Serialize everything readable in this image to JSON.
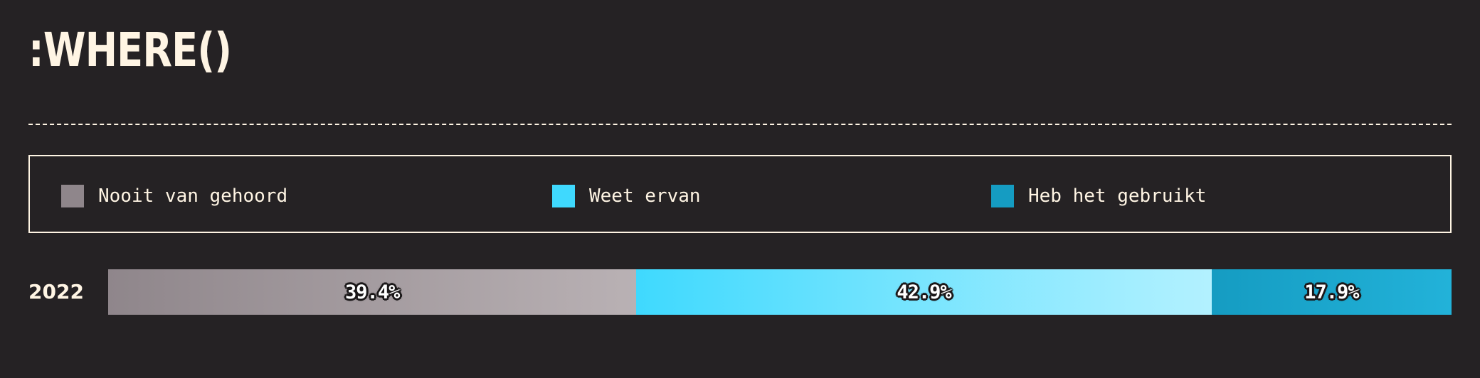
{
  "title": ":WHERE()",
  "legend": {
    "items": [
      {
        "label": "Nooit van gehoord",
        "color": "#8f868b"
      },
      {
        "label": "Weet ervan",
        "color": "#3fd9fe"
      },
      {
        "label": "Heb het gebruikt",
        "color": "#159cc2"
      }
    ]
  },
  "chart_data": {
    "type": "bar",
    "orientation": "horizontal",
    "stacked": true,
    "unit": "%",
    "categories": [
      "2022"
    ],
    "series": [
      {
        "name": "Nooit van gehoord",
        "values": [
          39.4
        ],
        "label": "39.4%",
        "color_from": "#8f868b",
        "color_to": "#b9b1b4"
      },
      {
        "name": "Weet ervan",
        "values": [
          42.9
        ],
        "label": "42.9%",
        "color_from": "#3fd9fe",
        "color_to": "#b3f1ff"
      },
      {
        "name": "Heb het gebruikt",
        "values": [
          17.9
        ],
        "label": "17.9%",
        "color_from": "#159cc2",
        "color_to": "#22b2d9"
      }
    ]
  }
}
